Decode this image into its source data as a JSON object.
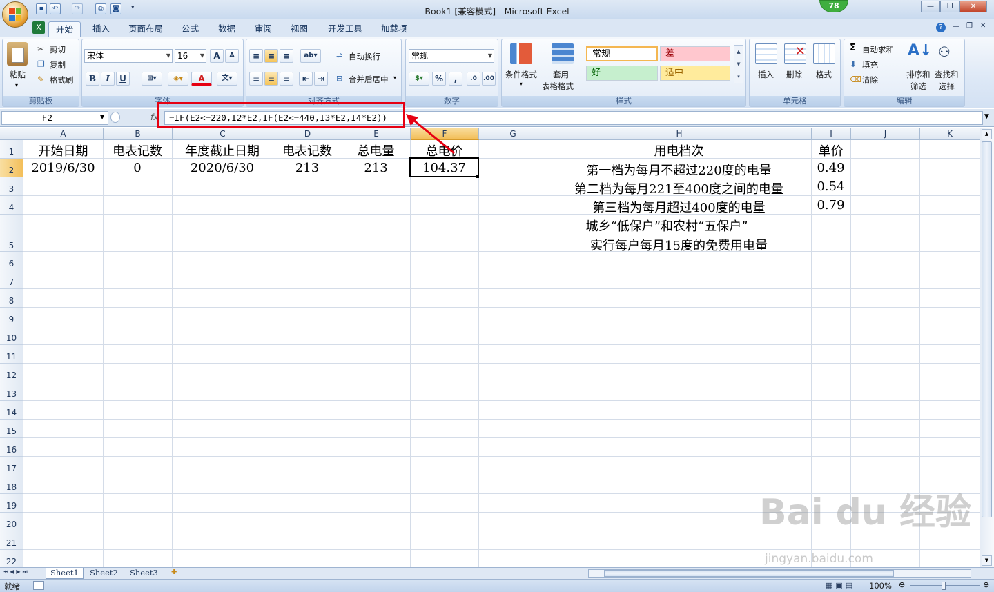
{
  "titlebar": {
    "title": "Book1  [兼容模式] - Microsoft Excel",
    "badge": "78"
  },
  "tabs": [
    "开始",
    "插入",
    "页面布局",
    "公式",
    "数据",
    "审阅",
    "视图",
    "开发工具",
    "加载项"
  ],
  "clipboard": {
    "paste": "粘贴",
    "cut": "剪切",
    "copy": "复制",
    "format_painter": "格式刷",
    "label": "剪贴板"
  },
  "font": {
    "name": "宋体",
    "size": "16",
    "label": "字体",
    "bold": "B",
    "italic": "I",
    "underline": "U"
  },
  "alignment": {
    "wrap": "自动换行",
    "merge": "合并后居中",
    "label": "对齐方式"
  },
  "number": {
    "format": "常规",
    "percent": "%",
    "comma": ",",
    "label": "数字"
  },
  "styles": {
    "cond_format": "条件格式",
    "table_format_1": "套用",
    "table_format_2": "表格格式",
    "normal": "常规",
    "bad": "差",
    "good": "好",
    "neutral": "适中",
    "label": "样式"
  },
  "cells_group": {
    "insert": "插入",
    "delete": "删除",
    "format": "格式",
    "label": "单元格"
  },
  "editing": {
    "autosum": "自动求和",
    "fill": "填充",
    "clear": "清除",
    "sort1": "排序和",
    "sort2": "筛选",
    "find1": "查找和",
    "find2": "选择",
    "label": "编辑"
  },
  "formula_bar": {
    "name_box": "F2",
    "fx": "fx",
    "formula": "=IF(E2<=220,I2*E2,IF(E2<=440,I3*E2,I4*E2))"
  },
  "columns": [
    "A",
    "B",
    "C",
    "D",
    "E",
    "F",
    "G",
    "H",
    "I",
    "J",
    "K"
  ],
  "rows": [
    "1",
    "2",
    "3",
    "4",
    "5",
    "6",
    "7",
    "8",
    "9",
    "10",
    "11",
    "12",
    "13",
    "14",
    "15",
    "16",
    "17",
    "18",
    "19",
    "20",
    "21",
    "22"
  ],
  "cells": {
    "A1": "开始日期",
    "B1": "电表记数",
    "C1": "年度截止日期",
    "D1": "电表记数",
    "E1": "总电量",
    "F1": "总电价",
    "H1": "用电档次",
    "I1": "单价",
    "A2": "2019/6/30",
    "B2": "0",
    "C2": "2020/6/30",
    "D2": "213",
    "E2": "213",
    "F2": "104.37",
    "H2": "第一档为每月不超过220度的电量",
    "I2": "0.49",
    "H3": "第二档为每月221至400度之间的电量",
    "I3": "0.54",
    "H4": "第三档为每月超过400度的电量",
    "I4": "0.79",
    "H5a": "城乡“低保户”和农村“五保户”",
    "H5b": "实行每户每月15度的免费用电量"
  },
  "sheets": [
    "Sheet1",
    "Sheet2",
    "Sheet3"
  ],
  "status": {
    "ready": "就绪",
    "zoom": "100%"
  },
  "watermark": {
    "brand": "Bai du 经验",
    "url": "jingyan.baidu.com"
  }
}
